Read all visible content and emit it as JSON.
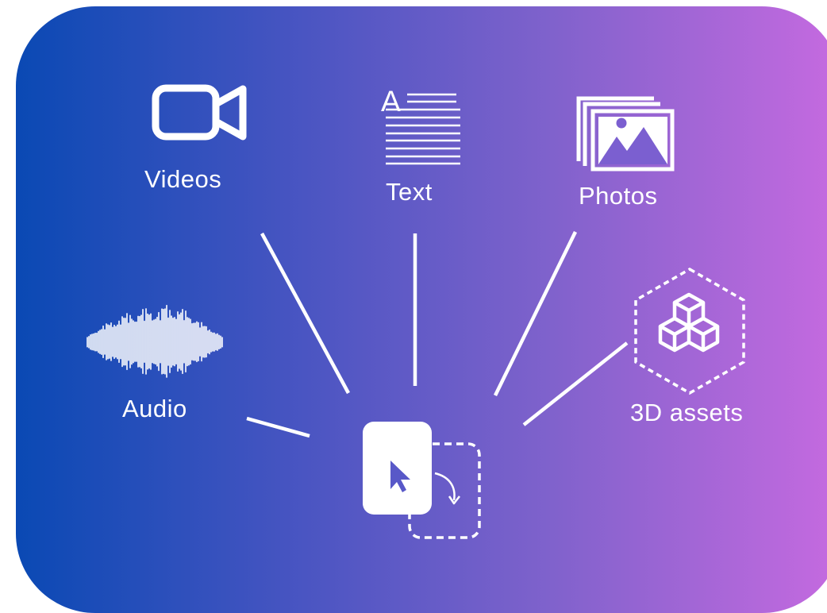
{
  "colors": {
    "gradient_start": "#0a49b4",
    "gradient_end": "#c66ae0",
    "foreground": "#ffffff",
    "cursor": "#5858c8"
  },
  "nodes": [
    {
      "id": "videos",
      "label": "Videos",
      "icon": "video-camera-icon"
    },
    {
      "id": "text",
      "label": "Text",
      "icon": "text-document-icon"
    },
    {
      "id": "photos",
      "label": "Photos",
      "icon": "photo-stack-icon"
    },
    {
      "id": "audio",
      "label": "Audio",
      "icon": "audio-waveform-icon"
    },
    {
      "id": "assets3d",
      "label": "3D assets",
      "icon": "3d-cubes-icon"
    }
  ],
  "center": {
    "icon": "drag-and-drop-cursor-icon"
  }
}
